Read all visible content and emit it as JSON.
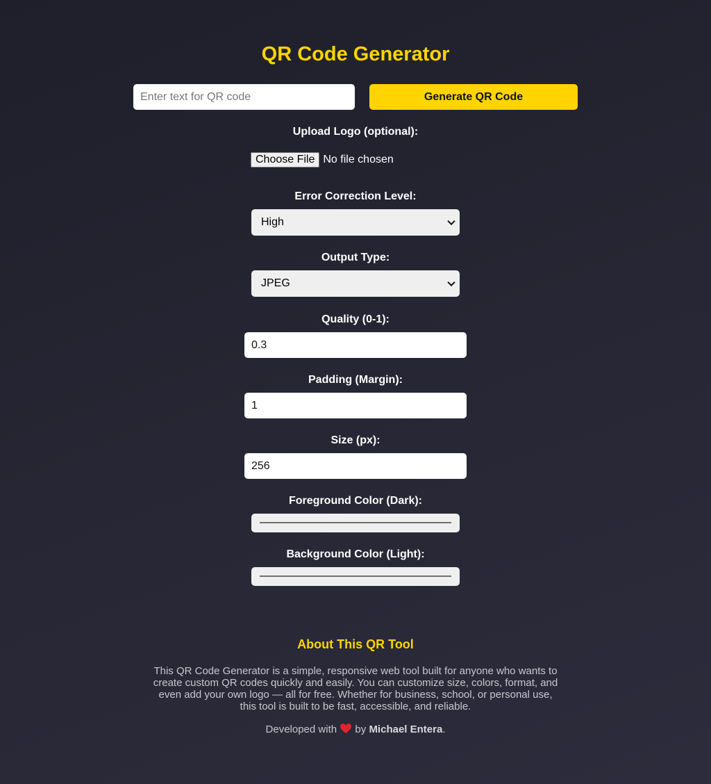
{
  "header": {
    "title": "QR Code Generator"
  },
  "text_input": {
    "placeholder": "Enter text for QR code",
    "value": ""
  },
  "generate_button": {
    "label": "Generate QR Code"
  },
  "logo_upload": {
    "label": "Upload Logo (optional):",
    "button_label": "Choose File",
    "status": "No file chosen"
  },
  "error_correction": {
    "label": "Error Correction Level:",
    "selected": "High"
  },
  "output_type": {
    "label": "Output Type:",
    "selected": "JPEG"
  },
  "quality": {
    "label": "Quality (0-1):",
    "value": "0.3"
  },
  "padding": {
    "label": "Padding (Margin):",
    "value": "1"
  },
  "size": {
    "label": "Size (px):",
    "value": "256"
  },
  "foreground_color": {
    "label": "Foreground Color (Dark):"
  },
  "background_color": {
    "label": "Background Color (Light):"
  },
  "about": {
    "title": "About This QR Tool",
    "lines": [
      "This QR Code Generator is a simple, responsive web tool built for anyone who wants to",
      "create custom QR codes quickly and easily. You can customize size, colors, format, and",
      "even add your own logo — all for free. Whether for business, school, or personal use,",
      "this tool is built to be fast, accessible, and reliable."
    ]
  },
  "credit": {
    "prefix": "Developed with",
    "connector": "by",
    "author": "Michael Entera",
    "suffix": "."
  },
  "colors": {
    "accent": "#ffd400",
    "background": "#262634",
    "heart": "#e0242c"
  },
  "icons": {
    "heart": "heart-icon",
    "select_arrow": "chevron-down-icon"
  }
}
